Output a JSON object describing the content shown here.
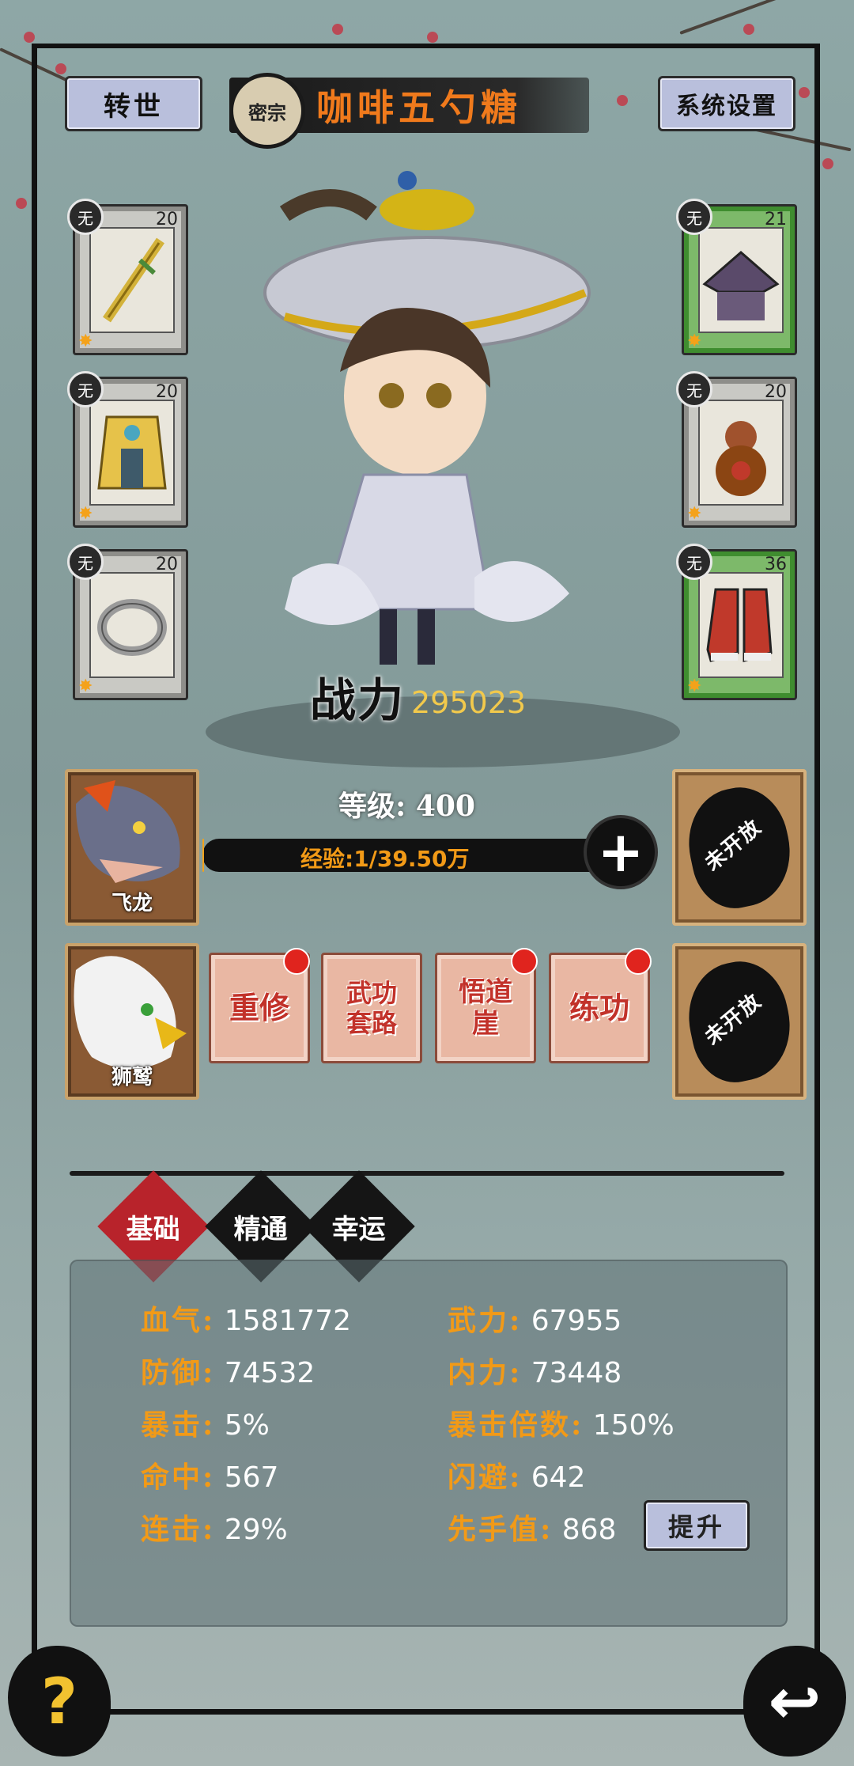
{
  "header": {
    "rebirth_label": "转世",
    "sect_label": "密宗",
    "player_name": "咖啡五勺糖",
    "settings_label": "系统设置"
  },
  "equipment": {
    "left": [
      {
        "tag": "无",
        "level": "20",
        "item": "sword"
      },
      {
        "tag": "无",
        "level": "20",
        "item": "armor"
      },
      {
        "tag": "无",
        "level": "20",
        "item": "ring"
      }
    ],
    "right": [
      {
        "tag": "无",
        "level": "21",
        "item": "hat"
      },
      {
        "tag": "无",
        "level": "20",
        "item": "gourd"
      },
      {
        "tag": "无",
        "level": "36",
        "item": "boots"
      }
    ]
  },
  "character": {
    "power_label": "战力",
    "power_value": "295023",
    "level_text": "等级: 400",
    "exp_text": "经验:1/39.50万"
  },
  "pets": [
    {
      "name": "飞龙"
    },
    {
      "name": "狮鹫"
    }
  ],
  "locked_slots": [
    "未开放",
    "未开放"
  ],
  "skills": [
    {
      "label": "重修",
      "badge": true
    },
    {
      "label": "武功套路",
      "badge": false
    },
    {
      "label": "悟道崖",
      "badge": true
    },
    {
      "label": "练功",
      "badge": true
    }
  ],
  "tabs": [
    {
      "label": "基础",
      "active": true
    },
    {
      "label": "精通",
      "active": false
    },
    {
      "label": "幸运",
      "active": false
    }
  ],
  "stats": {
    "left": [
      {
        "key": "血气:",
        "value": "1581772"
      },
      {
        "key": "防御:",
        "value": "74532"
      },
      {
        "key": "暴击:",
        "value": "5%"
      },
      {
        "key": "命中:",
        "value": "567"
      },
      {
        "key": "连击:",
        "value": "29%"
      }
    ],
    "right": [
      {
        "key": "武力:",
        "value": "67955"
      },
      {
        "key": "内力:",
        "value": "73448"
      },
      {
        "key": "暴击倍数:",
        "value": "150%"
      },
      {
        "key": "闪避:",
        "value": "642"
      },
      {
        "key": "先手值:",
        "value": "868"
      }
    ],
    "upgrade_label": "提升"
  },
  "footer": {
    "help_symbol": "?",
    "back_symbol": "↩"
  },
  "colors": {
    "accent_orange": "#f29a17",
    "name_orange": "#f07a1c",
    "tab_active": "#b8232b",
    "equip_green": "#7db96a"
  }
}
